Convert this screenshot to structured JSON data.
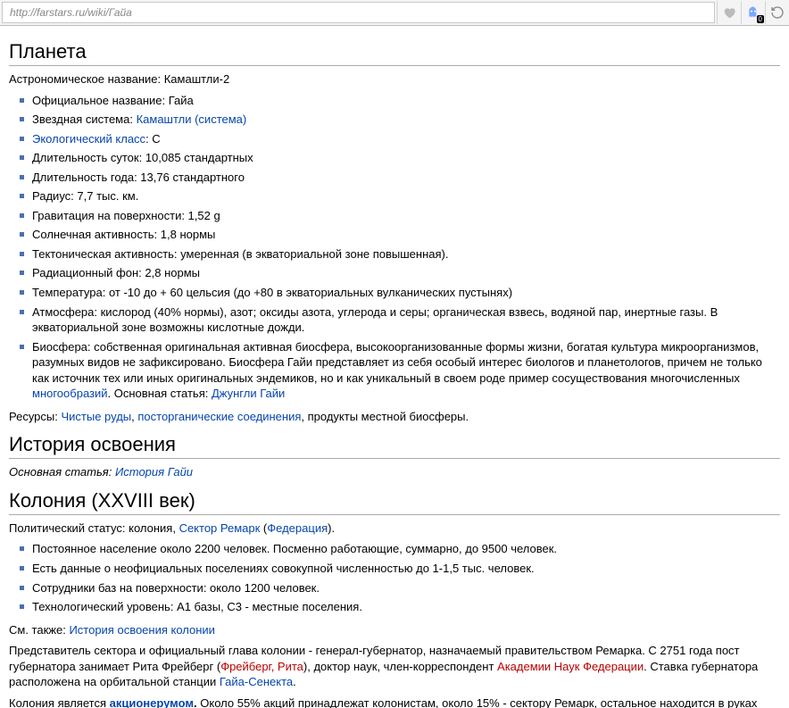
{
  "address_bar": {
    "url": "http://farstars.ru/wiki/Гайа",
    "badge": "0"
  },
  "sections": {
    "planet": {
      "heading": "Планета",
      "astro_label": "Астрономическое название: ",
      "astro_value": "Камаштли-2",
      "items": {
        "official": "Официальное название: Гайа",
        "star_label": "Звездная система: ",
        "star_link": "Камаштли (система)",
        "eco_link": "Экологический класс",
        "eco_rest": ": С",
        "day": "Длительность суток: 10,085 стандартных",
        "year": "Длительность года: 13,76 стандартного",
        "radius": "Радиус: 7,7 тыс. км.",
        "gravity": "Гравитация на поверхности: 1,52 g",
        "solar": "Солнечная активность: 1,8 нормы",
        "tectonic": "Тектоническая активность: умеренная (в экваториальной зоне повышенная).",
        "radiation": "Радиационный фон: 2,8 нормы",
        "temp": "Температура: от -10 до + 60 цельсия (до +80 в экваториальных вулканических пустынях)",
        "atmo": "Атмосфера: кислород (40% нормы), азот; оксиды азота, углерода и серы; органическая взвесь, водяной пар, инертные газы. В экваториальной зоне возможны кислотные дожди.",
        "bio_pre": "Биосфера: собственная оригинальная активная биосфера, высокоорганизованные формы жизни, богатая культура микроорганизмов, разумных видов не зафиксировано. Биосфера Гайи представляет из себя особый интерес биологов и планетологов, причем не только как источник тех или иных оригинальных эндемиков, но и как уникальный в своем роде пример сосуществования многочисленных ",
        "bio_link": "многообразий",
        "bio_mid": ". Основная статья: ",
        "bio_link2": "Джунгли Гайи"
      },
      "res_label": "Ресурсы: ",
      "res_link1": "Чистые руды",
      "res_sep": ", ",
      "res_link2": "посторганические соединения",
      "res_rest": ", продукты местной биосферы."
    },
    "history": {
      "heading": "История освоения",
      "main_label": "Основная статья: ",
      "main_link": "История Гайи"
    },
    "colony": {
      "heading": "Колония (XXVIII век)",
      "status_pre": "Политический статус: колония, ",
      "status_link1": "Сектор Ремарк",
      "status_mid": " (",
      "status_link2": "Федерация",
      "status_post": ").",
      "items": {
        "pop": "Постоянное население около 2200 человек. Посменно работающие, суммарно, до 9500 человек.",
        "unofficial": "Есть данные о неофициальных поселениях совокупной численностью до 1-1,5 тыс. человек.",
        "bases": "Сотрудники баз на поверхности: около 1200 человек.",
        "tech": "Технологический уровень: A1 базы, C3 - местные поселения."
      },
      "see_label": "См. также: ",
      "see_link": "История освоения колонии",
      "gov_pre": "Представитель сектора и официальный глава колонии - генерал-губернатор, назначаемый правительством Ремарка. С 2751 года пост губернатора занимает Рита Фрейберг (",
      "gov_red": "Фрейберг, Рита",
      "gov_mid": "), доктор наук, член-корреспондент ",
      "gov_red2": "Академии Наук Федерации",
      "gov_mid2": ". Ставка губернатора расположена на орбитальной станции ",
      "gov_link": "Гайа-Сенекта",
      "gov_post": ".",
      "shares_pre": "Колония является ",
      "shares_link": "акционерумом",
      "shares_bold": ".",
      "shares_post": " Около 55% акций принадлежат колонистам, около 15% - сектору Ремарк, остальное находится в руках"
    }
  }
}
